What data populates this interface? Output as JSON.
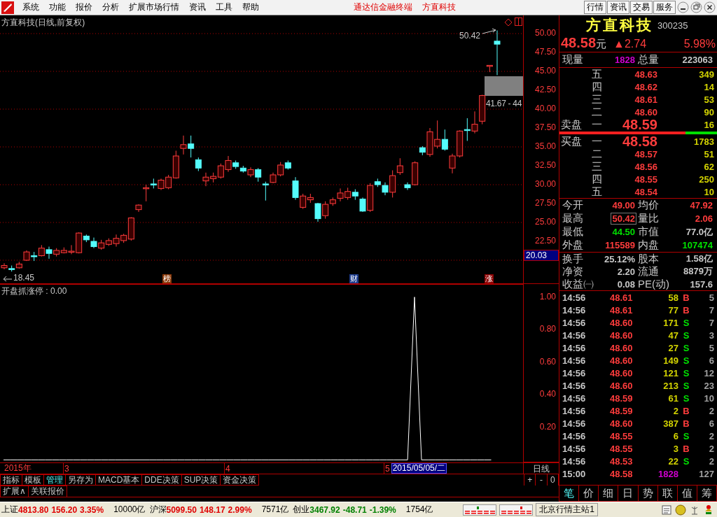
{
  "menu_bar": {
    "menus": [
      "系统",
      "功能",
      "报价",
      "分析",
      "扩展市场行情",
      "资讯",
      "工具",
      "帮助"
    ],
    "titles": [
      "通达信金融终端",
      "方直科技"
    ],
    "buttons": [
      "行情",
      "资讯",
      "交易",
      "服务"
    ]
  },
  "chart": {
    "cursor_price": "20.03",
    "high_label": "50.42",
    "low_label": "18.45",
    "zone_label": "41.67 - 44",
    "markers": [
      {
        "text": "榜",
        "color": "#8b3a0a"
      },
      {
        "text": "财",
        "color": "#1e3c8c"
      },
      {
        "text": "涨",
        "color": "#8b0000"
      }
    ],
    "chart_data": {
      "type": "candlestick",
      "title": "方直科技(日线,前复权)",
      "grid": true,
      "ylim": [
        16.85,
        52.41
      ],
      "yticks": [
        {
          "value": 50,
          "label": "50.00"
        },
        {
          "value": 47.5,
          "label": "47.50"
        },
        {
          "value": 45,
          "label": "45.00"
        },
        {
          "value": 42.5,
          "label": "42.50"
        },
        {
          "value": 40,
          "label": "40.00"
        },
        {
          "value": 37.5,
          "label": "37.50"
        },
        {
          "value": 35,
          "label": "35.00"
        },
        {
          "value": 32.5,
          "label": "32.50"
        },
        {
          "value": 30,
          "label": "30.00"
        },
        {
          "value": 27.5,
          "label": "27.50"
        },
        {
          "value": 25,
          "label": "25.00"
        },
        {
          "value": 22.5,
          "label": "22.50"
        }
      ],
      "categories": [
        null,
        null,
        null,
        null,
        null,
        null,
        null,
        null,
        null,
        null,
        null,
        null,
        null,
        null,
        null,
        null,
        null,
        null,
        null,
        null,
        null,
        null,
        null,
        null,
        null,
        null,
        null,
        null,
        null,
        null,
        null,
        null,
        null,
        null,
        null,
        null,
        null,
        null,
        null,
        null,
        null,
        null,
        null,
        null,
        null,
        null,
        null,
        null,
        null,
        null,
        null,
        null,
        null,
        null,
        null,
        null,
        null,
        null,
        null,
        null,
        null,
        null,
        null,
        null,
        null,
        null,
        null
      ],
      "ohlc": [
        [
          19.0,
          19.6,
          18.8,
          19.3
        ],
        [
          18.9,
          19.3,
          18.5,
          18.85
        ],
        [
          19.0,
          19.8,
          18.9,
          19.5
        ],
        [
          20.0,
          21.3,
          19.9,
          21.1
        ],
        [
          20.6,
          21.1,
          19.9,
          20.55
        ],
        [
          20.6,
          22.0,
          20.5,
          21.6
        ],
        [
          21.4,
          21.8,
          20.2,
          20.9
        ],
        [
          20.8,
          21.6,
          20.5,
          21.3
        ],
        [
          21.0,
          21.7,
          20.9,
          21.3
        ],
        [
          21.1,
          22.0,
          20.8,
          21.2
        ],
        [
          21.0,
          23.7,
          20.9,
          23.6
        ],
        [
          23.2,
          23.4,
          22.4,
          22.7
        ],
        [
          22.5,
          23.0,
          21.6,
          21.8
        ],
        [
          21.6,
          22.7,
          21.4,
          22.3
        ],
        [
          22.1,
          22.9,
          21.9,
          22.6
        ],
        [
          22.2,
          23.4,
          21.8,
          22.9
        ],
        [
          22.6,
          23.5,
          22.3,
          23.3
        ],
        [
          22.8,
          25.7,
          22.6,
          25.6
        ],
        [
          26.7,
          27.4,
          26.4,
          27.3
        ],
        [
          29.55,
          30.0,
          27.8,
          29.6
        ],
        [
          30.1,
          30.8,
          29.5,
          30.0
        ],
        [
          29.5,
          30.8,
          29.3,
          30.6
        ],
        [
          29.6,
          31.3,
          29.4,
          31.0
        ],
        [
          30.9,
          34.5,
          30.8,
          33.8
        ],
        [
          34.8,
          36.5,
          34.0,
          35.3
        ],
        [
          35.4,
          36.5,
          33.6,
          34.8
        ],
        [
          33.3,
          33.6,
          31.8,
          32.2
        ],
        [
          30.5,
          31.6,
          29.8,
          31.0
        ],
        [
          30.8,
          31.6,
          30.3,
          31.1
        ],
        [
          31.0,
          32.8,
          30.8,
          32.5
        ],
        [
          32.0,
          33.8,
          31.7,
          33.2
        ],
        [
          32.9,
          33.2,
          32.1,
          32.4
        ],
        [
          32.2,
          32.5,
          31.6,
          31.8
        ],
        [
          31.3,
          32.3,
          31.0,
          32.0
        ],
        [
          32.0,
          32.2,
          30.4,
          31.0
        ],
        [
          30.1,
          30.4,
          27.9,
          30.0
        ],
        [
          30.3,
          31.6,
          30.2,
          31.3
        ],
        [
          31.3,
          33.0,
          31.1,
          32.6
        ],
        [
          32.9,
          33.2,
          32.0,
          32.2
        ],
        [
          30.5,
          31.0,
          28.0,
          28.3
        ],
        [
          27.0,
          28.8,
          26.8,
          28.5
        ],
        [
          28.0,
          28.8,
          27.6,
          28.3
        ],
        [
          27.5,
          27.6,
          25.1,
          25.5
        ],
        [
          25.9,
          27.8,
          25.5,
          27.4
        ],
        [
          27.5,
          28.3,
          27.2,
          28.0
        ],
        [
          28.2,
          29.5,
          27.8,
          28.9
        ],
        [
          28.3,
          29.6,
          28.0,
          29.1
        ],
        [
          29.0,
          29.4,
          28.0,
          28.5
        ],
        [
          28.1,
          28.3,
          26.4,
          26.5
        ],
        [
          26.6,
          30.2,
          26.4,
          29.9
        ],
        [
          30.4,
          30.8,
          29.7,
          30.0
        ],
        [
          29.9,
          30.3,
          28.6,
          29.0
        ],
        [
          29.0,
          31.9,
          28.3,
          31.2
        ],
        [
          31.6,
          33.5,
          31.3,
          32.5
        ],
        [
          30.0,
          30.3,
          29.3,
          29.6
        ],
        [
          30.0,
          33.1,
          29.9,
          32.9
        ],
        [
          34.9,
          35.1,
          33.9,
          34.3
        ],
        [
          34.0,
          37.5,
          33.7,
          37.0
        ],
        [
          35.1,
          38.5,
          34.8,
          36.0
        ],
        [
          36.0,
          37.3,
          34.5,
          34.7
        ],
        [
          32.2,
          34.1,
          31.5,
          33.8
        ],
        [
          33.8,
          37.2,
          33.6,
          37.1
        ],
        [
          37.3,
          38.8,
          35.8,
          37.2
        ],
        [
          37.1,
          39.7,
          36.8,
          38.0
        ],
        [
          38.4,
          41.9,
          38.0,
          41.8
        ],
        [
          45.75,
          45.8,
          44.9,
          45.8
        ],
        [
          49.0,
          50.42,
          44.5,
          48.6
        ]
      ]
    }
  },
  "indicator": {
    "chart_data": {
      "type": "line",
      "title": "开盘抓涨停 : 0.00",
      "ylim": [
        -0.02,
        1.08
      ],
      "yticks": [
        {
          "value": 1,
          "label": "1.00"
        },
        {
          "value": 0.8,
          "label": "0.80"
        },
        {
          "value": 0.6,
          "label": "0.60"
        },
        {
          "value": 0.4,
          "label": "0.40"
        },
        {
          "value": 0.2,
          "label": "0.20"
        }
      ],
      "series": [
        {
          "color": "#ffffff",
          "values": [
            0,
            0,
            0,
            0,
            0,
            0,
            0,
            0,
            0,
            0,
            0,
            0,
            0,
            0,
            0,
            0,
            0,
            0,
            0,
            0,
            0,
            0,
            0,
            0,
            0,
            0,
            0,
            0,
            0,
            0,
            0,
            0,
            0,
            0,
            0,
            0,
            0,
            0,
            0,
            0,
            0,
            0,
            0,
            0,
            0,
            0,
            0,
            0,
            0,
            0,
            0,
            0,
            0,
            0,
            0,
            0,
            0,
            0,
            0,
            1,
            0,
            0,
            0,
            0,
            0,
            0,
            0,
            0,
            0,
            0,
            0
          ]
        }
      ]
    }
  },
  "date_axis": {
    "labels": [
      "2015年",
      "3",
      "4",
      "5"
    ],
    "cursor_date": "2015/05/05/二",
    "period": "日线"
  },
  "tabs": [
    {
      "label": "指标",
      "selected": false
    },
    {
      "label": "模板",
      "selected": false
    },
    {
      "label": "管理",
      "selected": true
    },
    {
      "label": "另存为",
      "selected": false
    },
    {
      "label": "MACD基本",
      "selected": false
    },
    {
      "label": "DDE决策",
      "selected": false
    },
    {
      "label": "SUP决策",
      "selected": false
    },
    {
      "label": "资金决策",
      "selected": false
    }
  ],
  "zoom_buttons": [
    "+",
    "-",
    "0"
  ],
  "extension_tabs": [
    "扩展∧",
    "关联报价"
  ],
  "quote": {
    "name": "方直科技",
    "code": "300235",
    "price": "48.58",
    "unit": "元",
    "change": "▲2.74",
    "pct": "5.98%",
    "volume_row": [
      {
        "label": "现量",
        "value": "1828",
        "color": "#d000d0"
      },
      {
        "label": "总量",
        "value": "223063",
        "color": "#c8c8c8"
      }
    ],
    "ask_title": "卖盘",
    "bid_title": "买盘",
    "asks": [
      {
        "level": "五",
        "price": "48.63",
        "volume": "349"
      },
      {
        "level": "四",
        "price": "48.62",
        "volume": "14"
      },
      {
        "level": "三",
        "price": "48.61",
        "volume": "53"
      },
      {
        "level": "二",
        "price": "48.60",
        "volume": "90"
      },
      {
        "level": "一",
        "price": "48.59",
        "volume": "16"
      }
    ],
    "balance": {
      "level": 0.8
    },
    "bids": [
      {
        "level": "一",
        "price": "48.58",
        "volume": "1783"
      },
      {
        "level": "二",
        "price": "48.57",
        "volume": "51"
      },
      {
        "level": "三",
        "price": "48.56",
        "volume": "62"
      },
      {
        "level": "四",
        "price": "48.55",
        "volume": "250"
      },
      {
        "level": "五",
        "price": "48.54",
        "volume": "10"
      }
    ],
    "stats": [
      {
        "label": "今开",
        "value": "49.00",
        "color": "#ff3c3c",
        "highlighted": false
      },
      {
        "label": "均价",
        "value": "47.92",
        "color": "#ff3c3c",
        "highlighted": false
      },
      {
        "label": "最高",
        "value": "50.42",
        "color": "#ff3c3c",
        "highlighted": true
      },
      {
        "label": "量比",
        "value": "2.06",
        "color": "#ff3c3c",
        "highlighted": false
      },
      {
        "label": "最低",
        "value": "44.50",
        "color": "#00e000",
        "highlighted": false
      },
      {
        "label": "市值",
        "value": "77.0亿",
        "color": "#c8c8c8",
        "highlighted": false
      },
      {
        "label": "外盘",
        "value": "115589",
        "color": "#ff3c3c",
        "highlighted": false
      },
      {
        "label": "内盘",
        "value": "107474",
        "color": "#00e000",
        "highlighted": false
      }
    ],
    "fundamentals": [
      {
        "label": "换手",
        "value": "25.12%"
      },
      {
        "label": "股本",
        "value": "1.58亿"
      },
      {
        "label": "净资",
        "value": "2.20"
      },
      {
        "label": "流通",
        "value": "8879万"
      },
      {
        "label": "收益㈠",
        "value": "0.08"
      },
      {
        "label": "PE(动)",
        "value": "157.6"
      }
    ],
    "trades": [
      {
        "time": "14:56",
        "price": "48.61",
        "volume": "58",
        "side": "B",
        "count": "5",
        "kind": "buy"
      },
      {
        "time": "14:56",
        "price": "48.61",
        "volume": "77",
        "side": "B",
        "count": "7",
        "kind": "buy"
      },
      {
        "time": "14:56",
        "price": "48.60",
        "volume": "171",
        "side": "S",
        "count": "7",
        "kind": "sell"
      },
      {
        "time": "14:56",
        "price": "48.60",
        "volume": "47",
        "side": "S",
        "count": "3",
        "kind": "sell"
      },
      {
        "time": "14:56",
        "price": "48.60",
        "volume": "27",
        "side": "S",
        "count": "5",
        "kind": "sell"
      },
      {
        "time": "14:56",
        "price": "48.60",
        "volume": "149",
        "side": "S",
        "count": "6",
        "kind": "sell"
      },
      {
        "time": "14:56",
        "price": "48.60",
        "volume": "121",
        "side": "S",
        "count": "12",
        "kind": "sell"
      },
      {
        "time": "14:56",
        "price": "48.60",
        "volume": "213",
        "side": "S",
        "count": "23",
        "kind": "sell"
      },
      {
        "time": "14:56",
        "price": "48.59",
        "volume": "61",
        "side": "S",
        "count": "10",
        "kind": "sell"
      },
      {
        "time": "14:56",
        "price": "48.59",
        "volume": "2",
        "side": "B",
        "count": "2",
        "kind": "buy"
      },
      {
        "time": "14:56",
        "price": "48.60",
        "volume": "387",
        "side": "B",
        "count": "6",
        "kind": "buy"
      },
      {
        "time": "14:56",
        "price": "48.55",
        "volume": "6",
        "side": "S",
        "count": "2",
        "kind": "sell"
      },
      {
        "time": "14:56",
        "price": "48.55",
        "volume": "3",
        "side": "B",
        "count": "2",
        "kind": "buy"
      },
      {
        "time": "14:56",
        "price": "48.53",
        "volume": "22",
        "side": "S",
        "count": "2",
        "kind": "sell"
      },
      {
        "time": "15:00",
        "price": "48.58",
        "volume": "1828",
        "count": "127",
        "kind": "close"
      }
    ],
    "tabs": [
      {
        "label": "笔",
        "selected": true
      },
      {
        "label": "价",
        "selected": false
      },
      {
        "label": "细",
        "selected": false
      },
      {
        "label": "日",
        "selected": false
      },
      {
        "label": "势",
        "selected": false
      },
      {
        "label": "联",
        "selected": false
      },
      {
        "label": "值",
        "selected": false
      },
      {
        "label": "筹",
        "selected": false
      }
    ]
  },
  "status_bar": {
    "indices": [
      {
        "name": "上证",
        "value": "4813.80",
        "change": "156.20",
        "pct": "3.35%",
        "amount": "10000亿",
        "color": "#e00000"
      },
      {
        "name": "沪深",
        "value": "5099.50",
        "change": "148.17",
        "pct": "2.99%",
        "amount": "7571亿",
        "color": "#e00000"
      },
      {
        "name": "创业",
        "value": "3467.92",
        "change": "-48.71",
        "pct": "-1.39%",
        "amount": "1754亿",
        "color": "#008000"
      }
    ],
    "server": "北京行情主站1"
  }
}
